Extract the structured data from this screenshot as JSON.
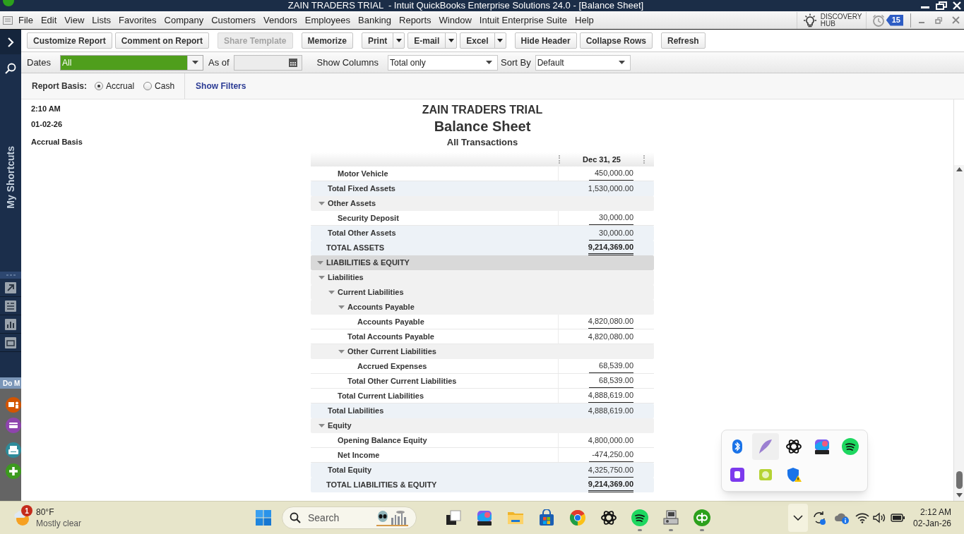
{
  "window": {
    "title": "ZAIN TRADERS TRIAL  - Intuit QuickBooks Enterprise Solutions 24.0 - [Balance Sheet]"
  },
  "menu": [
    "File",
    "Edit",
    "View",
    "Lists",
    "Favorites",
    "Company",
    "Customers",
    "Vendors",
    "Employees",
    "Banking",
    "Reports",
    "Window",
    "Intuit Enterprise Suite",
    "Help"
  ],
  "menu_right": {
    "discovery_hub": "DISCOVERY HUB",
    "reminders_count": "15"
  },
  "sidebar": {
    "title": "My Shortcuts",
    "section": "Do M"
  },
  "toolbar": {
    "groups": [
      [
        {
          "label": "Customize Report",
          "disabled": false,
          "dropdown": false
        },
        {
          "label": "Comment on Report",
          "disabled": false,
          "dropdown": false
        }
      ],
      [
        {
          "label": "Share Template",
          "disabled": true,
          "dropdown": false
        }
      ],
      [
        {
          "label": "Memorize",
          "disabled": false,
          "dropdown": false
        }
      ],
      [
        {
          "label": "Print",
          "disabled": false,
          "dropdown": true
        },
        {
          "label": "E-mail",
          "disabled": false,
          "dropdown": true
        },
        {
          "label": "Excel",
          "disabled": false,
          "dropdown": true
        }
      ],
      [
        {
          "label": "Hide Header",
          "disabled": false,
          "dropdown": false
        },
        {
          "label": "Collapse Rows",
          "disabled": false,
          "dropdown": false
        }
      ],
      [
        {
          "label": "Refresh",
          "disabled": false,
          "dropdown": false
        }
      ]
    ]
  },
  "filters": {
    "dates": {
      "label": "Dates",
      "value": "All",
      "focused": true
    },
    "as_of": {
      "label": "As of"
    },
    "show_columns": {
      "label": "Show Columns",
      "value": "Total only"
    },
    "sort_by": {
      "label": "Sort By",
      "value": "Default"
    }
  },
  "basis": {
    "label": "Report Basis:",
    "options": [
      {
        "label": "Accrual",
        "selected": true
      },
      {
        "label": "Cash",
        "selected": false
      }
    ],
    "show_filters": "Show Filters"
  },
  "report": {
    "time": "2:10 AM",
    "date": "01-02-26",
    "basis": "Accrual Basis",
    "company": "ZAIN TRADERS TRIAL",
    "title": "Balance Sheet",
    "subtitle": "All Transactions",
    "column": "Dec 31, 25",
    "rows": [
      {
        "kind": "group",
        "children": [
          {
            "kind": "group",
            "children": [
              {
                "kind": "account",
                "label": "Motor Vehicle",
                "amount": "450,000.00"
              },
              {
                "kind": "total",
                "label": "Total Fixed Assets",
                "amount": "1,530,000.00"
              }
            ]
          },
          {
            "kind": "group",
            "label": "Other Assets",
            "expanded": true,
            "children": [
              {
                "kind": "account",
                "label": "Security Deposit",
                "amount": "30,000.00"
              },
              {
                "kind": "total",
                "label": "Total Other Assets",
                "amount": "30,000.00"
              }
            ]
          },
          {
            "kind": "total",
            "label": "TOTAL ASSETS",
            "amount": "9,214,369.00"
          }
        ]
      },
      {
        "kind": "group",
        "label": "LIABILITIES & EQUITY",
        "expanded": true,
        "children": [
          {
            "kind": "group",
            "label": "Liabilities",
            "expanded": true,
            "children": [
              {
                "kind": "group",
                "label": "Current Liabilities",
                "expanded": true,
                "children": [
                  {
                    "kind": "group",
                    "label": "Accounts Payable",
                    "expanded": true,
                    "children": [
                      {
                        "kind": "account",
                        "label": "Accounts Payable",
                        "amount": "4,820,080.00"
                      },
                      {
                        "kind": "total",
                        "label": "Total Accounts Payable",
                        "amount": "4,820,080.00"
                      }
                    ]
                  },
                  {
                    "kind": "group",
                    "label": "Other Current Liabilities",
                    "expanded": true,
                    "children": [
                      {
                        "kind": "account",
                        "label": "Accrued Expenses",
                        "amount": "68,539.00"
                      },
                      {
                        "kind": "total",
                        "label": "Total Other Current Liabilities",
                        "amount": "68,539.00"
                      }
                    ]
                  },
                  {
                    "kind": "total",
                    "label": "Total Current Liabilities",
                    "amount": "4,888,619.00"
                  }
                ]
              },
              {
                "kind": "total",
                "label": "Total Liabilities",
                "amount": "4,888,619.00"
              }
            ]
          },
          {
            "kind": "group",
            "label": "Equity",
            "expanded": true,
            "children": [
              {
                "kind": "account",
                "label": "Opening Balance Equity",
                "amount": "4,800,000.00"
              },
              {
                "kind": "account",
                "label": "Net Income",
                "amount": "-474,250.00"
              },
              {
                "kind": "total",
                "label": "Total Equity",
                "amount": "4,325,750.00"
              }
            ]
          },
          {
            "kind": "total",
            "label": "TOTAL LIABILITIES & EQUITY",
            "amount": "9,214,369.00"
          }
        ]
      }
    ]
  },
  "taskbar": {
    "weather": {
      "badge": "1",
      "temperature": "80°F",
      "condition": "Mostly clear"
    },
    "search": {
      "placeholder": "Search"
    },
    "apps": [
      {
        "running": false
      },
      {
        "running": false
      },
      {
        "running": false
      },
      {
        "running": false
      },
      {
        "running": false
      },
      {
        "running": true
      },
      {
        "running": true
      },
      {
        "running": true
      }
    ],
    "clock": {
      "time": "2:12 AM",
      "date": "02-Jan-26"
    }
  }
}
